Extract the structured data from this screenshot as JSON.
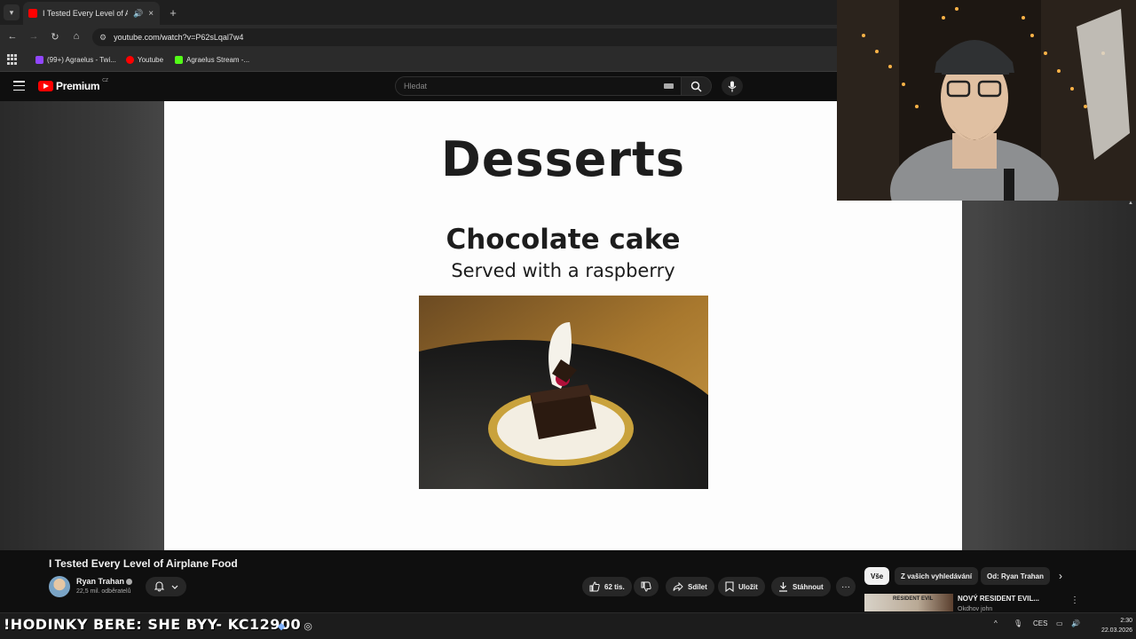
{
  "browser": {
    "tab_title": "I Tested Every Level of Airp",
    "tab_close": "×",
    "new_tab": "+",
    "url": "youtube.com/watch?v=P62sLqal7w4",
    "bookmarks": [
      {
        "label": "(99+) Agraelus - Twi...",
        "color": "#9146ff"
      },
      {
        "label": "Youtube",
        "color": "#ff0000"
      },
      {
        "label": "Agraelus Stream -...",
        "color": "#53fc18"
      }
    ]
  },
  "youtube": {
    "logo_text": "Premium",
    "region": "CZ",
    "search_placeholder": "Hledat"
  },
  "slide": {
    "title": "Desserts",
    "dish_name": "Chocolate cake",
    "dish_description": "Served with a raspberry"
  },
  "video": {
    "title": "I Tested Every Level of Airplane Food",
    "channel": "Ryan Trahan",
    "subscribers": "22,5 mil. odběratelů",
    "likes": "62 tis.",
    "share_label": "Sdílet",
    "save_label": "Uložit",
    "download_label": "Stáhnout",
    "more": "···"
  },
  "chips": [
    "Vše",
    "Z vašich vyhledávání",
    "Od: Ryan Trahan"
  ],
  "recommendation": {
    "title": "NOVÝ RESIDENT EVIL...",
    "subtitle": "Okdhov john",
    "thumb_text": "RESIDENT EVIL"
  },
  "taskbar": {
    "marquee": "!HODINKY BERE: SHE  BYY- KC12900",
    "lang": "CES",
    "time": "2:30",
    "date": "22.03.2026"
  },
  "colors": {
    "accent": "#ff0000",
    "background": "#0f0f0f",
    "slide_bg": "#fdfdfd"
  }
}
